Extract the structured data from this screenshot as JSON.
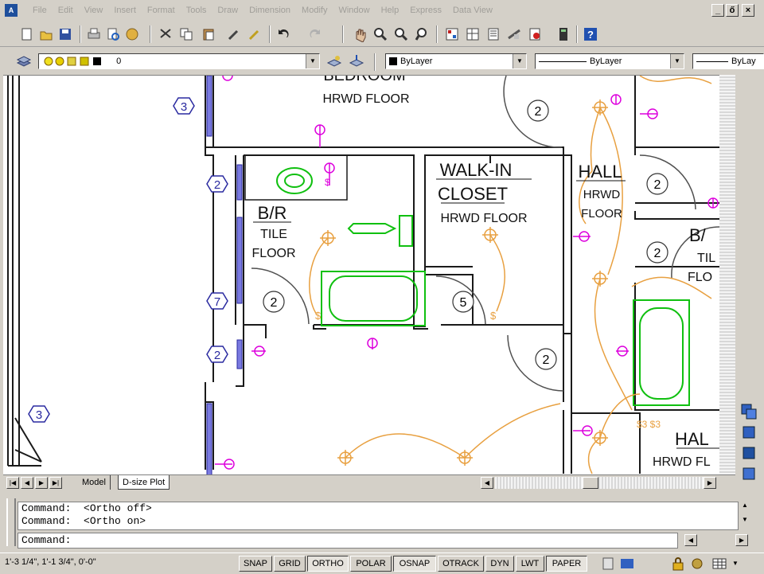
{
  "title_bar": {
    "menus": [
      "File",
      "Edit",
      "View",
      "Insert",
      "Format",
      "Tools",
      "Draw",
      "Dimension",
      "Modify",
      "Window",
      "Help",
      "Express",
      "Data View"
    ],
    "window_buttons": [
      "_",
      "ő",
      "×"
    ]
  },
  "layers_toolbar": {
    "layer_value": "0",
    "color_value": "ByLayer",
    "linetype_value": "ByLayer",
    "lineweight_value": "ByLay"
  },
  "drawing": {
    "rooms": {
      "bedroom_name": "BEDROOM",
      "bedroom_floor": "HRWD  FLOOR",
      "walkin_name_1": "WALK-IN",
      "walkin_name_2": "CLOSET",
      "walkin_floor": "HRWD  FLOOR",
      "br_name": "B/R",
      "br_floor_1": "TILE",
      "br_floor_2": "FLOOR",
      "hall_name": "HALL",
      "hall_floor_1": "HRWD",
      "hall_floor_2": "FLOOR",
      "br2_name": "B/",
      "br2_floor_1": "TIL",
      "br2_floor_2": "FLO",
      "hall2_name": "HAL",
      "hall2_floor": "HRWD  FL"
    },
    "door_tags": [
      "2",
      "2",
      "5",
      "2",
      "2",
      "2"
    ],
    "window_tags": [
      "3",
      "2",
      "7",
      "2",
      "3"
    ],
    "switch_tags": [
      "$",
      "$",
      "$3 $3"
    ]
  },
  "layout_tabs": {
    "model": "Model",
    "paper": "D-size Plot"
  },
  "command": {
    "history": [
      {
        "label": "Command:",
        "value": "<Ortho off>"
      },
      {
        "label": "Command:",
        "value": "<Ortho on>"
      }
    ],
    "prompt": "Command:"
  },
  "status": {
    "coordinates": "1'-3 1/4\",  1'-1 3/4\",  0'-0\"",
    "toggles": [
      {
        "label": "SNAP",
        "on": false
      },
      {
        "label": "GRID",
        "on": false
      },
      {
        "label": "ORTHO",
        "on": true
      },
      {
        "label": "POLAR",
        "on": false
      },
      {
        "label": "OSNAP",
        "on": true
      },
      {
        "label": "OTRACK",
        "on": false
      },
      {
        "label": "DYN",
        "on": false
      },
      {
        "label": "LWT",
        "on": false
      },
      {
        "label": "PAPER",
        "on": true
      }
    ]
  },
  "colors": {
    "wall": "#1a1a1a",
    "window": "#6666dd",
    "tag": "#2a2aa0",
    "fixture": "#10c010",
    "outlet": "#dd00dd",
    "wiring": "#e8a040",
    "door_swing": "#505050"
  },
  "icons": {
    "toolbar1": [
      "new-icon",
      "open-icon",
      "save-icon",
      "plot-icon",
      "plot-preview-icon",
      "publish-icon",
      "cut-icon",
      "copy-icon",
      "paste-icon",
      "match-properties-icon",
      "block-editor-icon",
      "undo-icon",
      "redo-icon",
      "pan-icon",
      "zoom-realtime-icon",
      "zoom-window-icon",
      "zoom-previous-icon",
      "properties-icon",
      "design-center-icon",
      "tool-palettes-icon",
      "sheet-set-icon",
      "markup-icon",
      "quickcalc-icon",
      "help-icon"
    ],
    "toolbar2": [
      "layer-manager-icon",
      "layer-state-icon",
      "layer-previous-icon"
    ]
  }
}
